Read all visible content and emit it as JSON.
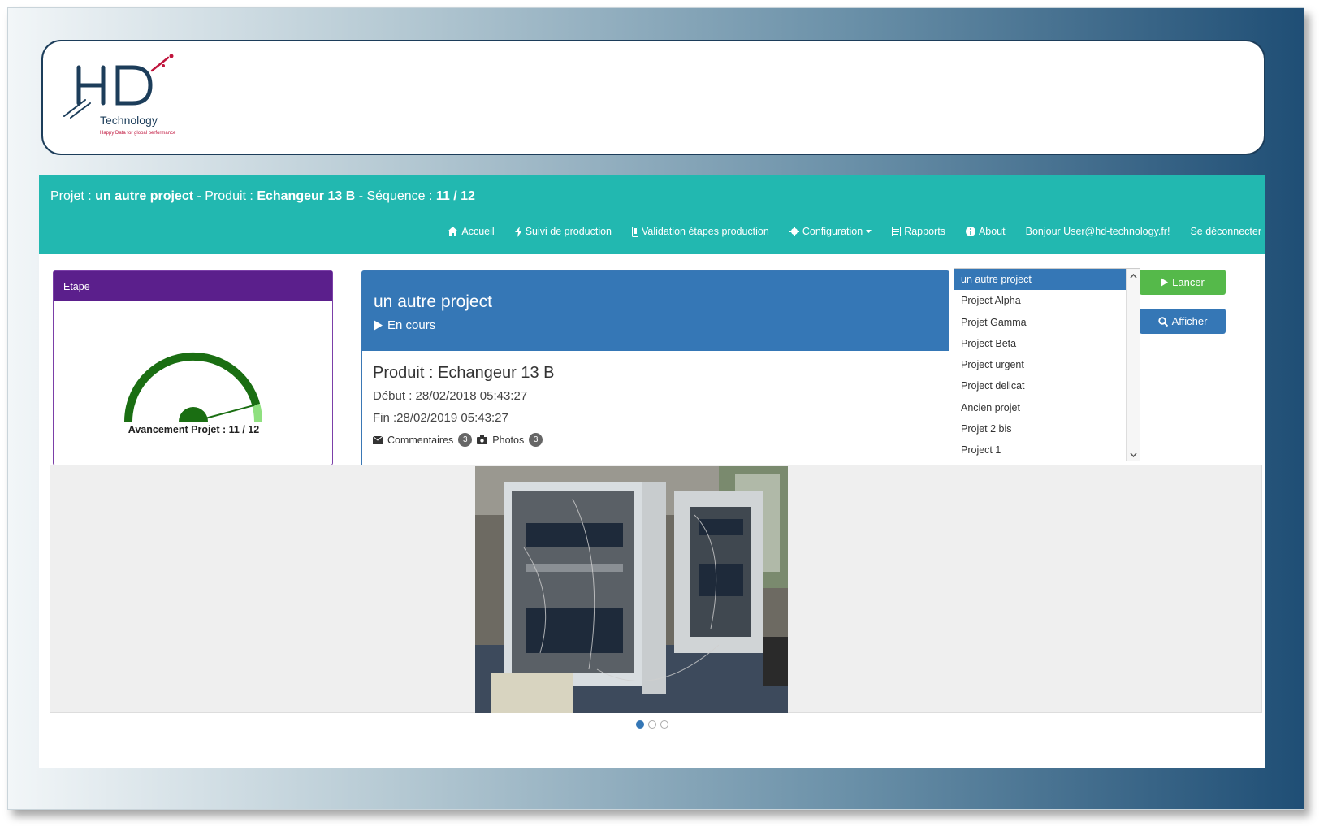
{
  "logo": {
    "mark": "HD",
    "name": "Technology",
    "tagline": "Happy Data for global performance"
  },
  "header": {
    "label_projet": "Projet :",
    "projet": "un autre project",
    "label_produit": "- Produit :",
    "produit": "Echangeur 13 B",
    "label_sequence": "- Séquence :",
    "sequence": "11 / 12"
  },
  "nav": {
    "accueil": "Accueil",
    "suivi": "Suivi de production",
    "validation": "Validation étapes production",
    "configuration": "Configuration",
    "rapports": "Rapports",
    "about": "About",
    "user": "Bonjour User@hd-technology.fr!",
    "logout": "Se déconnecter"
  },
  "etape": {
    "title": "Etape",
    "gauge_label": "Avancement Projet : 11 / 12",
    "progress": 0.9167
  },
  "project": {
    "title": "un autre project",
    "status": "En cours",
    "produit": "Produit : Echangeur 13 B",
    "debut": "Début : 28/02/2018 05:43:27",
    "fin": "Fin :28/02/2019 05:43:27",
    "comments_label": "Commentaires",
    "comments_count": "3",
    "photos_label": "Photos",
    "photos_count": "3"
  },
  "project_list": [
    "un autre project",
    "Project Alpha",
    "Projet Gamma",
    "Project Beta",
    "Project urgent",
    "Project delicat",
    "Ancien projet",
    "Projet 2 bis",
    "Project 1"
  ],
  "buttons": {
    "lancer": "Lancer",
    "afficher": "Afficher"
  },
  "colors": {
    "teal": "#22b8b0",
    "purple": "#5b1f8c",
    "blue": "#3577b6",
    "green": "#55b94a",
    "gauge_dark": "#1a6e12",
    "gauge_light": "#8fe07f"
  }
}
